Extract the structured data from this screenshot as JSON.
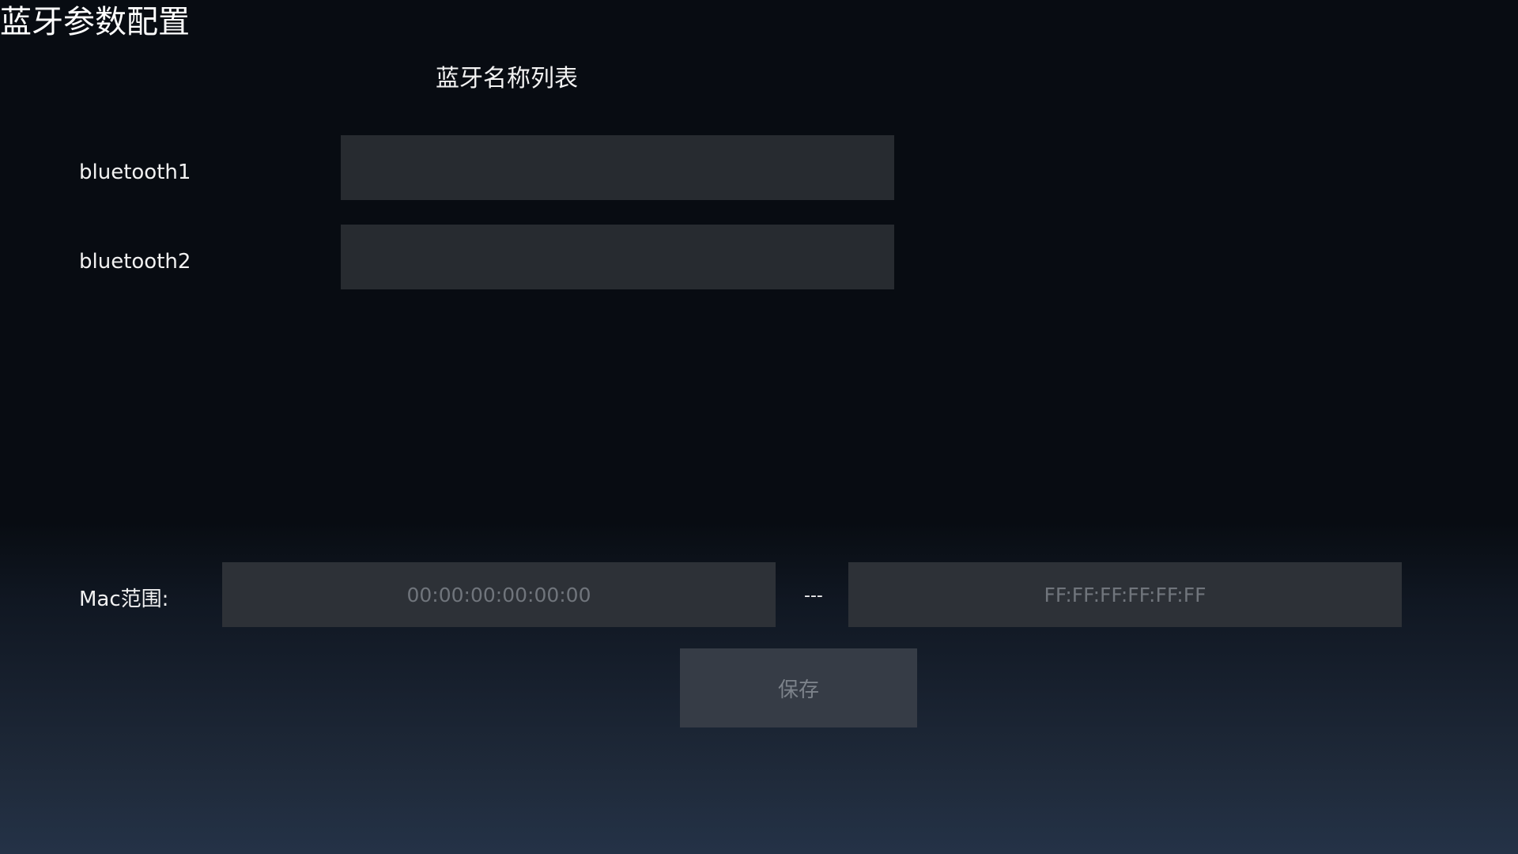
{
  "header": {
    "title": "蓝牙参数配置"
  },
  "bluetooth_names": {
    "title": "蓝牙名称列表",
    "rows": [
      {
        "label": "bluetooth1",
        "value": ""
      },
      {
        "label": "bluetooth2",
        "value": ""
      }
    ]
  },
  "mac_range": {
    "label": "Mac范围:",
    "separator": "---",
    "start_placeholder": "00:00:00:00:00:00",
    "end_placeholder": "FF:FF:FF:FF:FF:FF"
  },
  "actions": {
    "save_label": "保存"
  },
  "colors": {
    "background_top": "#080c12",
    "background_bottom": "#243247",
    "input_background": "#272b30",
    "button_background": "#363c46",
    "button_text": "#7c828a"
  }
}
